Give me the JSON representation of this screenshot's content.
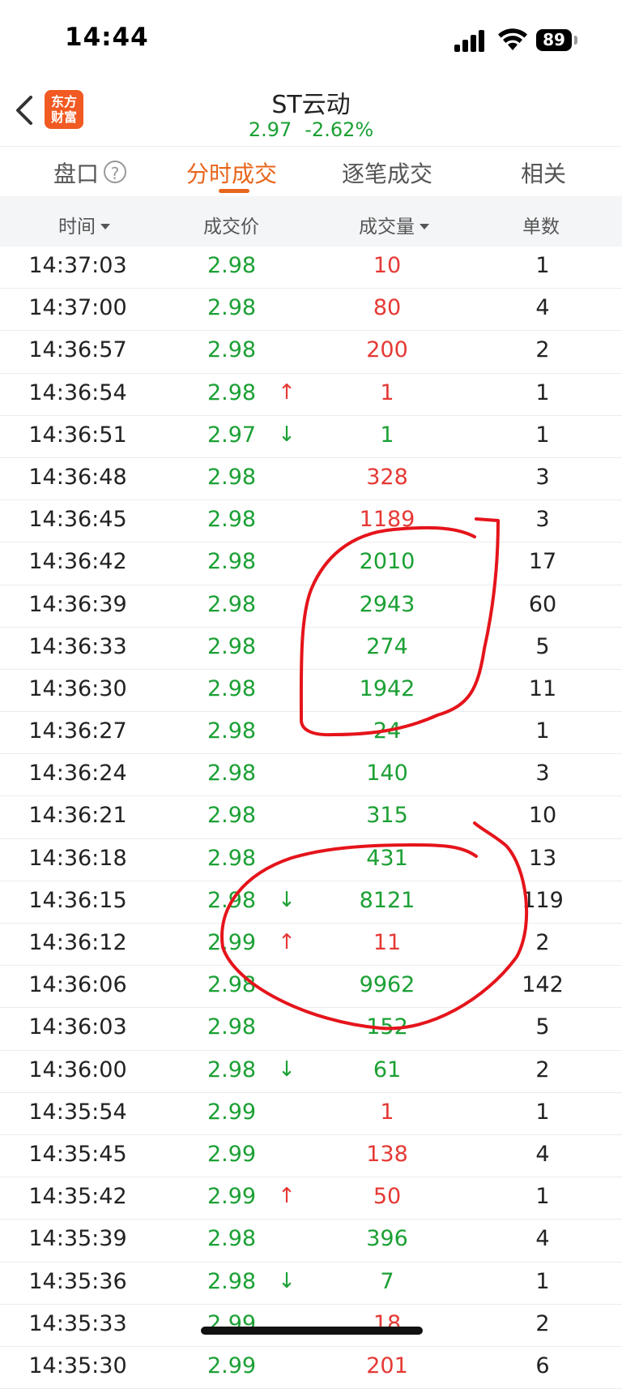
{
  "status_bar": {
    "time": "14:44",
    "battery": "89"
  },
  "header": {
    "logo_line1": "东方",
    "logo_line2": "财富",
    "title": "ST云动",
    "price": "2.97",
    "change": "-2.62%"
  },
  "tabs": [
    "盘口",
    "分时成交",
    "逐笔成交",
    "相关"
  ],
  "tab_help": "?",
  "columns": [
    "时间",
    "成交价",
    "成交量",
    "单数"
  ],
  "colors": {
    "up": "#e53935",
    "down": "#1ba034",
    "accent": "#e8661c",
    "logo": "#f15a22"
  },
  "trades": [
    {
      "time": "14:37:03",
      "price": "2.98",
      "arrow": "",
      "volume": "10",
      "vol_color": "red",
      "count": "1"
    },
    {
      "time": "14:37:00",
      "price": "2.98",
      "arrow": "",
      "volume": "80",
      "vol_color": "red",
      "count": "4"
    },
    {
      "time": "14:36:57",
      "price": "2.98",
      "arrow": "",
      "volume": "200",
      "vol_color": "red",
      "count": "2"
    },
    {
      "time": "14:36:54",
      "price": "2.98",
      "arrow": "↑",
      "volume": "1",
      "vol_color": "red",
      "count": "1"
    },
    {
      "time": "14:36:51",
      "price": "2.97",
      "arrow": "↓",
      "volume": "1",
      "vol_color": "green",
      "count": "1"
    },
    {
      "time": "14:36:48",
      "price": "2.98",
      "arrow": "",
      "volume": "328",
      "vol_color": "red",
      "count": "3"
    },
    {
      "time": "14:36:45",
      "price": "2.98",
      "arrow": "",
      "volume": "1189",
      "vol_color": "red",
      "count": "3"
    },
    {
      "time": "14:36:42",
      "price": "2.98",
      "arrow": "",
      "volume": "2010",
      "vol_color": "green",
      "count": "17"
    },
    {
      "time": "14:36:39",
      "price": "2.98",
      "arrow": "",
      "volume": "2943",
      "vol_color": "green",
      "count": "60"
    },
    {
      "time": "14:36:33",
      "price": "2.98",
      "arrow": "",
      "volume": "274",
      "vol_color": "green",
      "count": "5"
    },
    {
      "time": "14:36:30",
      "price": "2.98",
      "arrow": "",
      "volume": "1942",
      "vol_color": "green",
      "count": "11"
    },
    {
      "time": "14:36:27",
      "price": "2.98",
      "arrow": "",
      "volume": "24",
      "vol_color": "green",
      "count": "1"
    },
    {
      "time": "14:36:24",
      "price": "2.98",
      "arrow": "",
      "volume": "140",
      "vol_color": "green",
      "count": "3"
    },
    {
      "time": "14:36:21",
      "price": "2.98",
      "arrow": "",
      "volume": "315",
      "vol_color": "green",
      "count": "10"
    },
    {
      "time": "14:36:18",
      "price": "2.98",
      "arrow": "",
      "volume": "431",
      "vol_color": "green",
      "count": "13"
    },
    {
      "time": "14:36:15",
      "price": "2.98",
      "arrow": "↓",
      "volume": "8121",
      "vol_color": "green",
      "count": "119"
    },
    {
      "time": "14:36:12",
      "price": "2.99",
      "arrow": "↑",
      "volume": "11",
      "vol_color": "red",
      "count": "2"
    },
    {
      "time": "14:36:06",
      "price": "2.98",
      "arrow": "",
      "volume": "9962",
      "vol_color": "green",
      "count": "142"
    },
    {
      "time": "14:36:03",
      "price": "2.98",
      "arrow": "",
      "volume": "152",
      "vol_color": "green",
      "count": "5"
    },
    {
      "time": "14:36:00",
      "price": "2.98",
      "arrow": "↓",
      "volume": "61",
      "vol_color": "green",
      "count": "2"
    },
    {
      "time": "14:35:54",
      "price": "2.99",
      "arrow": "",
      "volume": "1",
      "vol_color": "red",
      "count": "1"
    },
    {
      "time": "14:35:45",
      "price": "2.99",
      "arrow": "",
      "volume": "138",
      "vol_color": "red",
      "count": "4"
    },
    {
      "time": "14:35:42",
      "price": "2.99",
      "arrow": "↑",
      "volume": "50",
      "vol_color": "red",
      "count": "1"
    },
    {
      "time": "14:35:39",
      "price": "2.98",
      "arrow": "",
      "volume": "396",
      "vol_color": "green",
      "count": "4"
    },
    {
      "time": "14:35:36",
      "price": "2.98",
      "arrow": "↓",
      "volume": "7",
      "vol_color": "green",
      "count": "1"
    },
    {
      "time": "14:35:33",
      "price": "2.99",
      "arrow": "",
      "volume": "18",
      "vol_color": "red",
      "count": "2"
    },
    {
      "time": "14:35:30",
      "price": "2.99",
      "arrow": "",
      "volume": "201",
      "vol_color": "red",
      "count": "6"
    }
  ]
}
